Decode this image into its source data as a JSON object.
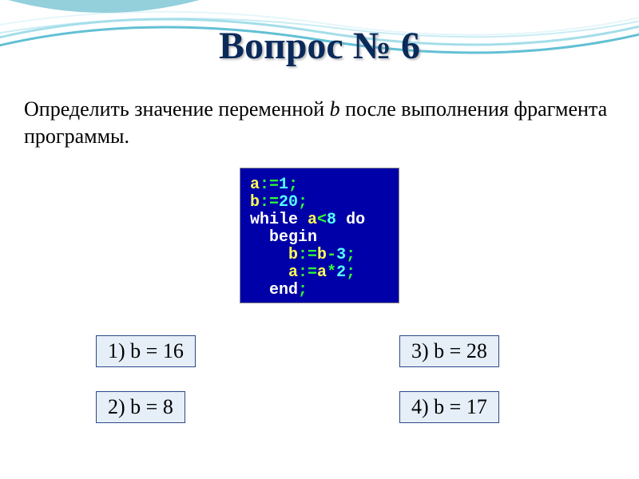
{
  "title": "Вопрос № 6",
  "question": {
    "part1": "Определить значение переменной ",
    "var": "b",
    "part2": " после выполнения фрагмента программы."
  },
  "code": {
    "line1": {
      "t1": "a",
      "op1": ":=",
      "n1": "1",
      "sc": ";"
    },
    "line2": {
      "t1": "b",
      "op1": ":=",
      "n1": "20",
      "sc": ";"
    },
    "line3": {
      "kw1": "while ",
      "v1": "a",
      "op1": "<",
      "n1": "8",
      "kw2": " do"
    },
    "line4": {
      "kw1": "  begin"
    },
    "line5": {
      "pad": "    ",
      "v1": "b",
      "op1": ":=",
      "v2": "b",
      "op2": "-",
      "n1": "3",
      "sc": ";"
    },
    "line6": {
      "pad": "    ",
      "v1": "a",
      "op1": ":=",
      "v2": "a",
      "op2": "*",
      "n1": "2",
      "sc": ";"
    },
    "line7": {
      "kw1": "  end",
      "sc": ";"
    }
  },
  "answers": {
    "a1": "1) b = 16",
    "a2": "2) b = 8",
    "a3": "3) b = 28",
    "a4": "4) b = 17"
  },
  "colors": {
    "accent": "#0a2a5a",
    "codebg": "#0000a8",
    "answerbg": "#e6eef7",
    "answerborder": "#2a4a8a"
  }
}
